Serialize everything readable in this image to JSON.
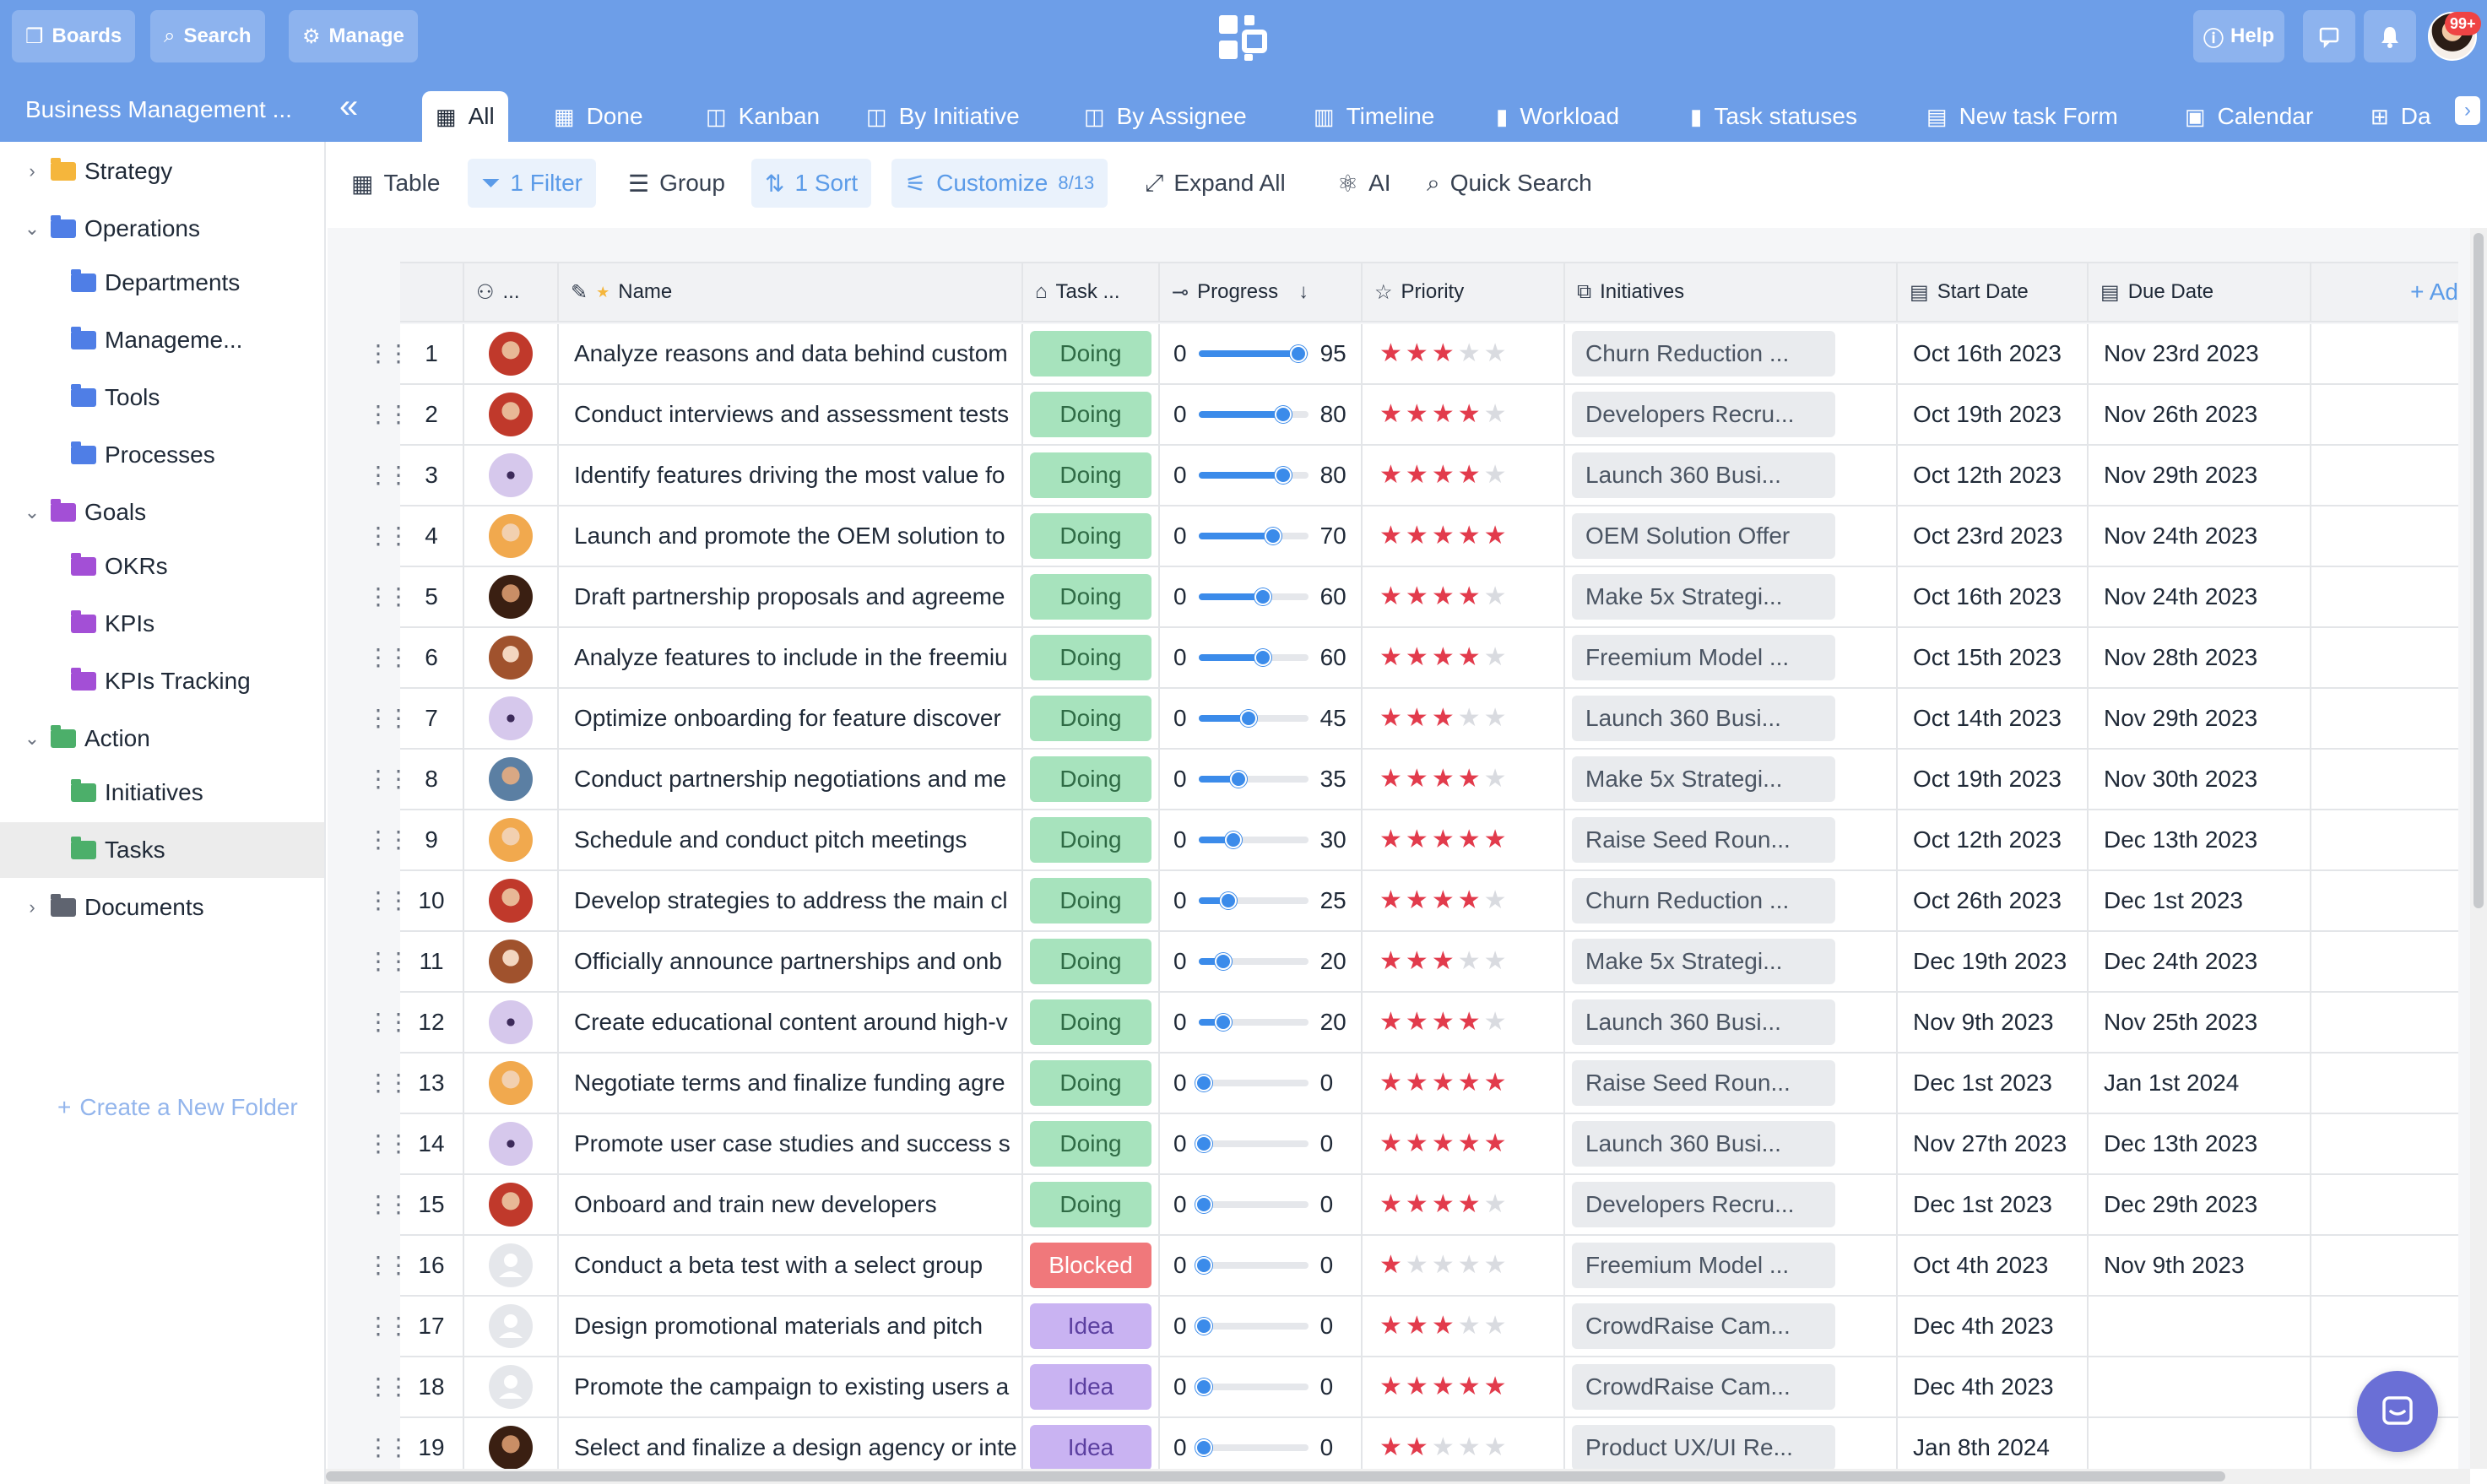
{
  "topbar": {
    "boards_label": "Boards",
    "search_label": "Search",
    "manage_label": "Manage",
    "help_label": "Help",
    "notification_count": "99+"
  },
  "tabbar": {
    "board_title": "Business Management ...",
    "collapse_glyph": "«",
    "tabs": [
      {
        "label": "All",
        "icon": "table-icon",
        "active": true
      },
      {
        "label": "Done",
        "icon": "table-icon"
      },
      {
        "label": "Kanban",
        "icon": "kanban-icon"
      },
      {
        "label": "By Initiative",
        "icon": "kanban-icon"
      },
      {
        "label": "By Assignee",
        "icon": "kanban-icon"
      },
      {
        "label": "Timeline",
        "icon": "timeline-icon"
      },
      {
        "label": "Workload",
        "icon": "bar-chart-icon"
      },
      {
        "label": "Task statuses",
        "icon": "bar-chart-icon"
      },
      {
        "label": "New task Form",
        "icon": "form-icon"
      },
      {
        "label": "Calendar",
        "icon": "calendar-icon"
      },
      {
        "label": "Da",
        "icon": "dashboard-icon"
      }
    ]
  },
  "sidebar": {
    "items": [
      {
        "label": "Strategy",
        "level": 0,
        "caret": "›",
        "color": "#f5b63c"
      },
      {
        "label": "Operations",
        "level": 0,
        "caret": "⌄",
        "color": "#4f7ee6"
      },
      {
        "label": "Departments",
        "level": 1,
        "color": "#4f7ee6"
      },
      {
        "label": "Manageme...",
        "level": 1,
        "color": "#4f7ee6"
      },
      {
        "label": "Tools",
        "level": 1,
        "color": "#4f7ee6"
      },
      {
        "label": "Processes",
        "level": 1,
        "color": "#4f7ee6"
      },
      {
        "label": "Goals",
        "level": 0,
        "caret": "⌄",
        "color": "#a34fd6"
      },
      {
        "label": "OKRs",
        "level": 1,
        "color": "#a34fd6"
      },
      {
        "label": "KPIs",
        "level": 1,
        "color": "#a34fd6"
      },
      {
        "label": "KPIs Tracking",
        "level": 1,
        "color": "#a34fd6"
      },
      {
        "label": "Action",
        "level": 0,
        "caret": "⌄",
        "color": "#4caf6a"
      },
      {
        "label": "Initiatives",
        "level": 1,
        "color": "#4caf6a"
      },
      {
        "label": "Tasks",
        "level": 1,
        "color": "#4caf6a",
        "selected": true
      },
      {
        "label": "Documents",
        "level": 0,
        "caret": "›",
        "color": "#5f6470"
      }
    ],
    "create_folder": "Create a New Folder"
  },
  "toolbar": {
    "table_label": "Table",
    "filter_label": "1 Filter",
    "group_label": "Group",
    "sort_label": "1 Sort",
    "customize_label": "Customize",
    "customize_count": "8/13",
    "expand_label": "Expand All",
    "ai_label": "AI",
    "quick_search_label": "Quick Search"
  },
  "grid": {
    "columns": {
      "assignee": "...",
      "name": "Name",
      "task_status": "Task ...",
      "progress": "Progress",
      "priority": "Priority",
      "initiatives": "Initiatives",
      "start_date": "Start Date",
      "due_date": "Due Date",
      "add": "+ Ad"
    },
    "progress_min": "0",
    "rows": [
      {
        "num": "1",
        "avatar": "a1",
        "name": "Analyze reasons and data behind custom",
        "status": "Doing",
        "progress": 95,
        "progress_label": "95",
        "priority": 3,
        "initiative": "Churn Reduction ...",
        "start": "Oct 16th 2023",
        "due": "Nov 23rd 2023"
      },
      {
        "num": "2",
        "avatar": "a1",
        "name": "Conduct interviews and assessment tests",
        "status": "Doing",
        "progress": 80,
        "progress_label": "80",
        "priority": 4,
        "initiative": "Developers Recru...",
        "start": "Oct 19th 2023",
        "due": "Nov 26th 2023"
      },
      {
        "num": "3",
        "avatar": "a2",
        "name": "Identify features driving the most value fo",
        "status": "Doing",
        "progress": 80,
        "progress_label": "80",
        "priority": 4,
        "initiative": "Launch 360 Busi...",
        "start": "Oct 12th 2023",
        "due": "Nov 29th 2023"
      },
      {
        "num": "4",
        "avatar": "a3",
        "name": "Launch and promote the OEM solution to",
        "status": "Doing",
        "progress": 70,
        "progress_label": "70",
        "priority": 5,
        "initiative": "OEM Solution Offer",
        "start": "Oct 23rd 2023",
        "due": "Nov 24th 2023"
      },
      {
        "num": "5",
        "avatar": "a4",
        "name": "Draft partnership proposals and agreeme",
        "status": "Doing",
        "progress": 60,
        "progress_label": "60",
        "priority": 4,
        "initiative": "Make 5x Strategi...",
        "start": "Oct 16th 2023",
        "due": "Nov 24th 2023"
      },
      {
        "num": "6",
        "avatar": "a5",
        "name": "Analyze features to include in the freemiu",
        "status": "Doing",
        "progress": 60,
        "progress_label": "60",
        "priority": 4,
        "initiative": "Freemium Model ...",
        "start": "Oct 15th 2023",
        "due": "Nov 28th 2023"
      },
      {
        "num": "7",
        "avatar": "a2",
        "name": "Optimize onboarding for feature discover",
        "status": "Doing",
        "progress": 45,
        "progress_label": "45",
        "priority": 3,
        "initiative": "Launch 360 Busi...",
        "start": "Oct 14th 2023",
        "due": "Nov 29th 2023"
      },
      {
        "num": "8",
        "avatar": "a6",
        "name": "Conduct partnership negotiations and me",
        "status": "Doing",
        "progress": 35,
        "progress_label": "35",
        "priority": 4,
        "initiative": "Make 5x Strategi...",
        "start": "Oct 19th 2023",
        "due": "Nov 30th 2023"
      },
      {
        "num": "9",
        "avatar": "a3",
        "name": "Schedule and conduct pitch meetings",
        "status": "Doing",
        "progress": 30,
        "progress_label": "30",
        "priority": 5,
        "initiative": "Raise Seed Roun...",
        "start": "Oct 12th 2023",
        "due": "Dec 13th 2023"
      },
      {
        "num": "10",
        "avatar": "a1",
        "name": "Develop strategies to address the main cl",
        "status": "Doing",
        "progress": 25,
        "progress_label": "25",
        "priority": 4,
        "initiative": "Churn Reduction ...",
        "start": "Oct 26th 2023",
        "due": "Dec 1st 2023"
      },
      {
        "num": "11",
        "avatar": "a5",
        "name": "Officially announce partnerships and onb",
        "status": "Doing",
        "progress": 20,
        "progress_label": "20",
        "priority": 3,
        "initiative": "Make 5x Strategi...",
        "start": "Dec 19th 2023",
        "due": "Dec 24th 2023"
      },
      {
        "num": "12",
        "avatar": "a2",
        "name": "Create educational content around high-v",
        "status": "Doing",
        "progress": 20,
        "progress_label": "20",
        "priority": 4,
        "initiative": "Launch 360 Busi...",
        "start": "Nov 9th 2023",
        "due": "Nov 25th 2023"
      },
      {
        "num": "13",
        "avatar": "a3",
        "name": "Negotiate terms and finalize funding agre",
        "status": "Doing",
        "progress": 0,
        "progress_label": "0",
        "priority": 5,
        "initiative": "Raise Seed Roun...",
        "start": "Dec 1st 2023",
        "due": "Jan 1st 2024"
      },
      {
        "num": "14",
        "avatar": "a2",
        "name": "Promote user case studies and success s",
        "status": "Doing",
        "progress": 0,
        "progress_label": "0",
        "priority": 5,
        "initiative": "Launch 360 Busi...",
        "start": "Nov 27th 2023",
        "due": "Dec 13th 2023"
      },
      {
        "num": "15",
        "avatar": "a1",
        "name": "Onboard and train new developers",
        "status": "Doing",
        "progress": 0,
        "progress_label": "0",
        "priority": 4,
        "initiative": "Developers Recru...",
        "start": "Dec 1st 2023",
        "due": "Dec 29th 2023"
      },
      {
        "num": "16",
        "avatar": "none",
        "name": "Conduct a beta test with a select group",
        "status": "Blocked",
        "progress": 0,
        "progress_label": "0",
        "priority": 1,
        "initiative": "Freemium Model ...",
        "start": "Oct 4th 2023",
        "due": "Nov 9th 2023"
      },
      {
        "num": "17",
        "avatar": "none",
        "name": "Design promotional materials and pitch",
        "status": "Idea",
        "progress": 0,
        "progress_label": "0",
        "priority": 3,
        "initiative": "CrowdRaise Cam...",
        "start": "Dec 4th 2023",
        "due": ""
      },
      {
        "num": "18",
        "avatar": "none",
        "name": "Promote the campaign to existing users a",
        "status": "Idea",
        "progress": 0,
        "progress_label": "0",
        "priority": 5,
        "initiative": "CrowdRaise Cam...",
        "start": "Dec 4th 2023",
        "due": ""
      },
      {
        "num": "19",
        "avatar": "a4",
        "name": "Select and finalize a design agency or inte",
        "status": "Idea",
        "progress": 0,
        "progress_label": "0",
        "priority": 2,
        "initiative": "Product UX/UI Re...",
        "start": "Jan 8th 2024",
        "due": ""
      }
    ]
  },
  "colors": {
    "brand": "#6d9ee8",
    "doing": "#a7e3bd",
    "blocked": "#f0787b",
    "idea": "#c9b3f2",
    "star": "#e23b4c",
    "progress": "#3b8bea"
  }
}
